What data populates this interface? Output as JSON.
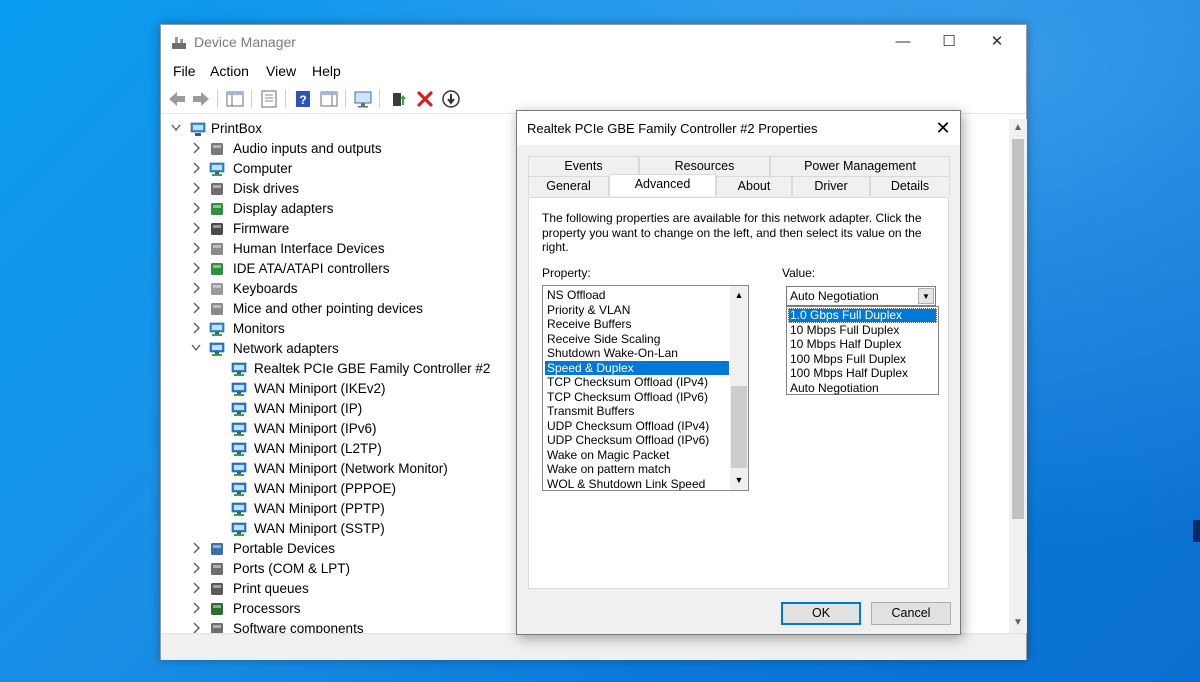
{
  "window": {
    "title": "Device Manager",
    "icon": "device-manager-icon",
    "controls": {
      "minimize": "—",
      "maximize": "☐",
      "close": "✕"
    }
  },
  "menu": {
    "file": "File",
    "action": "Action",
    "view": "View",
    "help": "Help"
  },
  "toolbar": {
    "icons": [
      "back-arrow-icon",
      "forward-arrow-icon",
      "show-hide-console-tree-icon",
      "properties-sheet-icon",
      "help-icon",
      "action-pane-icon",
      "monitor-scan-icon",
      "update-driver-icon",
      "uninstall-device-icon",
      "disable-device-icon"
    ]
  },
  "tree": {
    "root": "PrintBox",
    "categories": [
      {
        "label": "Audio inputs and outputs",
        "icon": "speaker-icon",
        "expanded": false
      },
      {
        "label": "Computer",
        "icon": "computer-icon",
        "expanded": false
      },
      {
        "label": "Disk drives",
        "icon": "disk-drive-icon",
        "expanded": false
      },
      {
        "label": "Display adapters",
        "icon": "display-adapter-icon",
        "expanded": false
      },
      {
        "label": "Firmware",
        "icon": "firmware-icon",
        "expanded": false
      },
      {
        "label": "Human Interface Devices",
        "icon": "hid-icon",
        "expanded": false
      },
      {
        "label": "IDE ATA/ATAPI controllers",
        "icon": "ide-controller-icon",
        "expanded": false
      },
      {
        "label": "Keyboards",
        "icon": "keyboard-icon",
        "expanded": false
      },
      {
        "label": "Mice and other pointing devices",
        "icon": "mouse-icon",
        "expanded": false
      },
      {
        "label": "Monitors",
        "icon": "monitor-icon",
        "expanded": false
      },
      {
        "label": "Network adapters",
        "icon": "network-adapter-icon",
        "expanded": true
      }
    ],
    "network_children": [
      "Realtek PCIe GBE Family Controller #2",
      "WAN Miniport (IKEv2)",
      "WAN Miniport (IP)",
      "WAN Miniport (IPv6)",
      "WAN Miniport (L2TP)",
      "WAN Miniport (Network Monitor)",
      "WAN Miniport (PPPOE)",
      "WAN Miniport (PPTP)",
      "WAN Miniport (SSTP)"
    ],
    "categories_after": [
      {
        "label": "Portable Devices",
        "icon": "portable-device-icon"
      },
      {
        "label": "Ports (COM & LPT)",
        "icon": "port-icon"
      },
      {
        "label": "Print queues",
        "icon": "printer-icon"
      },
      {
        "label": "Processors",
        "icon": "processor-icon"
      },
      {
        "label": "Software components",
        "icon": "software-component-icon"
      }
    ]
  },
  "dialog": {
    "title": "Realtek PCIe GBE Family Controller #2 Properties",
    "close": "✕",
    "tabs_top": [
      "Events",
      "Resources",
      "Power Management"
    ],
    "tabs_bottom": [
      "General",
      "Advanced",
      "About",
      "Driver",
      "Details"
    ],
    "active_tab": "Advanced",
    "description": "The following properties are available for this network adapter. Click the property you want to change on the left, and then select its value on the right.",
    "property_label": "Property:",
    "value_label": "Value:",
    "properties": [
      "NS Offload",
      "Priority & VLAN",
      "Receive Buffers",
      "Receive Side Scaling",
      "Shutdown Wake-On-Lan",
      "Speed & Duplex",
      "TCP Checksum Offload (IPv4)",
      "TCP Checksum Offload (IPv6)",
      "Transmit Buffers",
      "UDP Checksum Offload (IPv4)",
      "UDP Checksum Offload (IPv6)",
      "Wake on Magic Packet",
      "Wake on pattern match",
      "WOL & Shutdown Link Speed"
    ],
    "selected_property": "Speed & Duplex",
    "value_current": "Auto Negotiation",
    "value_options": [
      "1.0 Gbps Full Duplex",
      "10 Mbps Full Duplex",
      "10 Mbps Half Duplex",
      "100 Mbps Full Duplex",
      "100 Mbps Half Duplex",
      "Auto Negotiation"
    ],
    "highlighted_option": "1.0 Gbps Full Duplex",
    "ok": "OK",
    "cancel": "Cancel"
  },
  "colors": {
    "selection": "#0078d7",
    "desktop": "#0a8ae6"
  }
}
